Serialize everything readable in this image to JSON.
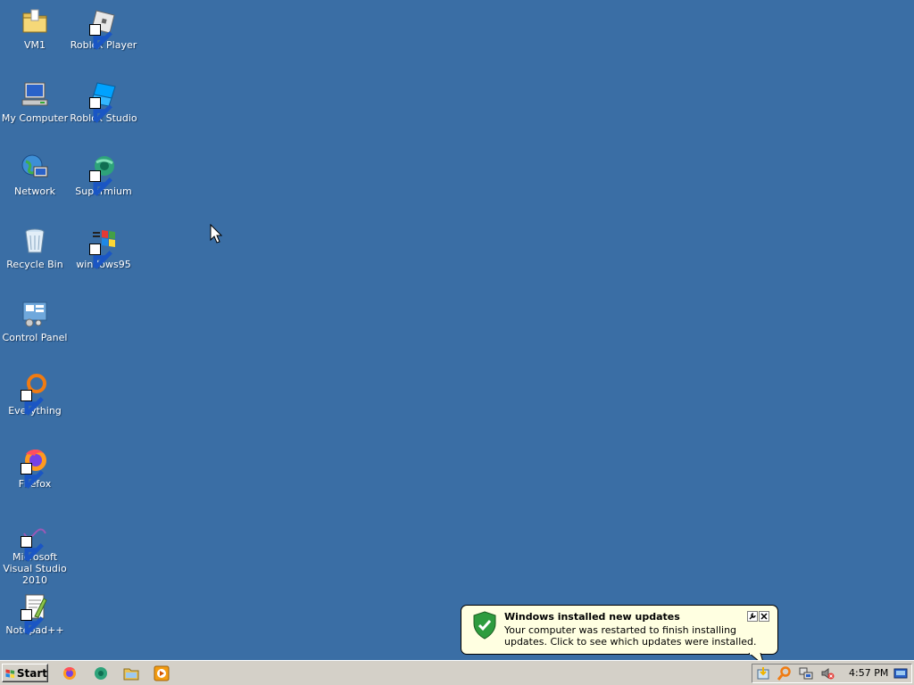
{
  "desktop": {
    "background_color": "#3a6ea5",
    "icons": [
      {
        "label": "VM1",
        "icon": "folder-icon"
      },
      {
        "label": "My Computer",
        "icon": "computer-icon"
      },
      {
        "label": "Network",
        "icon": "network-icon"
      },
      {
        "label": "Recycle Bin",
        "icon": "recycle-bin-icon"
      },
      {
        "label": "Control Panel",
        "icon": "control-panel-icon"
      },
      {
        "label": "Everything",
        "icon": "everything-search-icon"
      },
      {
        "label": "Firefox",
        "icon": "firefox-icon"
      },
      {
        "label": "Microsoft Visual Studio 2010",
        "icon": "visual-studio-icon"
      },
      {
        "label": "Notepad++",
        "icon": "notepad-plus-plus-icon"
      },
      {
        "label": "Roblox Player",
        "icon": "roblox-player-icon"
      },
      {
        "label": "Roblox Studio",
        "icon": "roblox-studio-icon"
      },
      {
        "label": "Supermium",
        "icon": "supermium-icon"
      },
      {
        "label": "windows95",
        "icon": "windows-logo-icon"
      }
    ]
  },
  "taskbar": {
    "start_label": "Start",
    "quick_launch": [
      "firefox-icon",
      "supermium-icon",
      "explorer-icon",
      "media-player-icon"
    ],
    "tray_icons": [
      "updates-icon",
      "search-icon",
      "network-icon",
      "volume-muted-icon",
      "keyboard-icon"
    ],
    "clock": "4:57 PM"
  },
  "notification": {
    "title": "Windows installed new updates",
    "message": "Your computer was restarted to finish installing updates. Click to see which updates were installed.",
    "icon": "shield-check-icon"
  }
}
